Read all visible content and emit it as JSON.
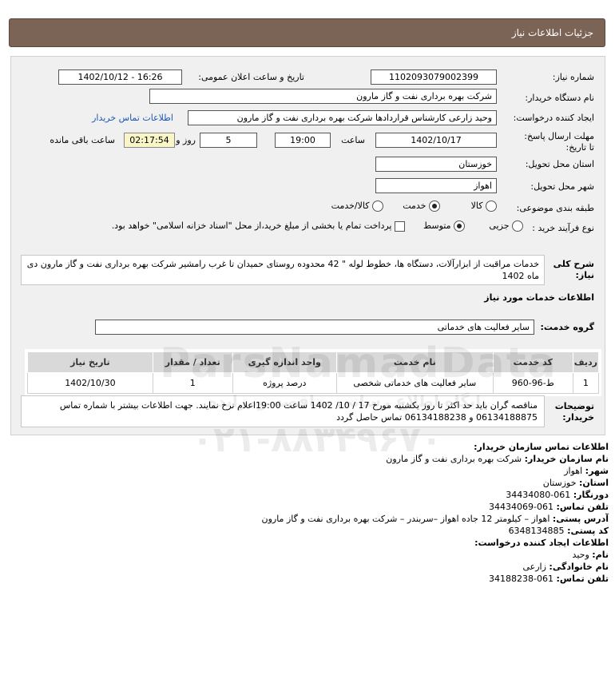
{
  "header": {
    "title": "جزئیات اطلاعات نیاز"
  },
  "fields": {
    "need_number_label": "شماره نیاز:",
    "need_number": "1102093079002399",
    "announce_label": "تاریخ و ساعت اعلان عمومی:",
    "announce_value": "1402/10/12 - 16:26",
    "buyer_org_label": "نام دستگاه خریدار:",
    "buyer_org": "شرکت بهره برداری نفت و گاز مارون",
    "creator_label": "ایجاد کننده درخواست:",
    "creator": "وحید زارعی کارشناس قراردادها شرکت بهره برداری نفت و گاز مارون",
    "contact_link": "اطلاعات تماس خریدار",
    "deadline_label": "مهلت ارسال پاسخ: تا تاریخ:",
    "deadline_date": "1402/10/17",
    "time_label": "ساعت",
    "deadline_time": "19:00",
    "days": "5",
    "days_label": "روز و",
    "remaining": "02:17:54",
    "remaining_label": "ساعت باقی مانده",
    "province_label": "استان محل تحویل:",
    "province": "خوزستان",
    "city_label": "شهر محل تحویل:",
    "city": "اهواز",
    "category_label": "طبقه بندی موضوعی:",
    "category_options": [
      "کالا",
      "خدمت",
      "کالا/خدمت"
    ],
    "category_selected": "خدمت",
    "process_label": "نوع فرآیند خرید :",
    "process_options": [
      "جزیی",
      "متوسط"
    ],
    "process_selected": "متوسط",
    "payment_note": "پرداخت تمام یا بخشی از مبلغ خرید،از محل \"اسناد خزانه اسلامی\" خواهد بود."
  },
  "summary": {
    "label": "شرح کلی نیاز:",
    "text": "خدمات مراقبت از ابزارآلات، دستگاه ها، خطوط لوله \" 42 محدوده روستای حمیدان تا غرب رامشیر شرکت بهره برداری نفت و گاز مارون دی ماه 1402"
  },
  "services": {
    "title": "اطلاعات خدمات مورد نیاز",
    "group_label": "گروه خدمت:",
    "group_value": "سایر فعالیت های خدماتی",
    "columns": [
      "ردیف",
      "کد خدمت",
      "نام خدمت",
      "واحد اندازه گیری",
      "تعداد / مقدار",
      "تاریخ نیاز"
    ],
    "rows": [
      [
        "1",
        "ط-96-960",
        "سایر فعالیت های خدماتی شخصی",
        "درصد پروژه",
        "1",
        "1402/10/30"
      ]
    ]
  },
  "notes": {
    "label": "توضیحات خریدار:",
    "text": "مناقصه گران باید حد اکثر تا روز یکشنبه مورخ 17 / 10/ 1402 ساعت 19:00اعلام نرخ نمایند. جهت اطلاعات بیشتر با شماره تماس 06134188875 و 06134188238 تماس حاصل گردد"
  },
  "contact": {
    "title": "اطلاعات تماس سازمان خریدار:",
    "org_label": "نام سازمان خریدار:",
    "org": "شرکت بهره برداری نفت و گاز مارون",
    "city_label": "شهر:",
    "city": "اهواز",
    "province_label": "استان:",
    "province": "خوزستان",
    "fax_label": "دورنگار:",
    "fax": "061-34434080",
    "phone_label": "تلفن تماس:",
    "phone": "061-34434069",
    "address_label": "آدرس پستی:",
    "address": "اهواز – کیلومتر 12 جاده اهواز –سربندر – شرکت بهره برداری نفت و گاز مارون",
    "postal_label": "کد پستی:",
    "postal": "6348134885",
    "creator_title": "اطلاعات ایجاد کننده درخواست:",
    "name_label": "نام:",
    "name": "وحید",
    "family_label": "نام خانوادگی:",
    "family": "زارعی",
    "creator_phone_label": "تلفن تماس:",
    "creator_phone": "061-34188238"
  },
  "watermark": {
    "brand": "ParsNamadData",
    "tagline": "پایگاه اطلاع رسانی مناقصه ومزایده",
    "phone": "۰۲۱-۸۸۳۴۹۶۷۰"
  }
}
